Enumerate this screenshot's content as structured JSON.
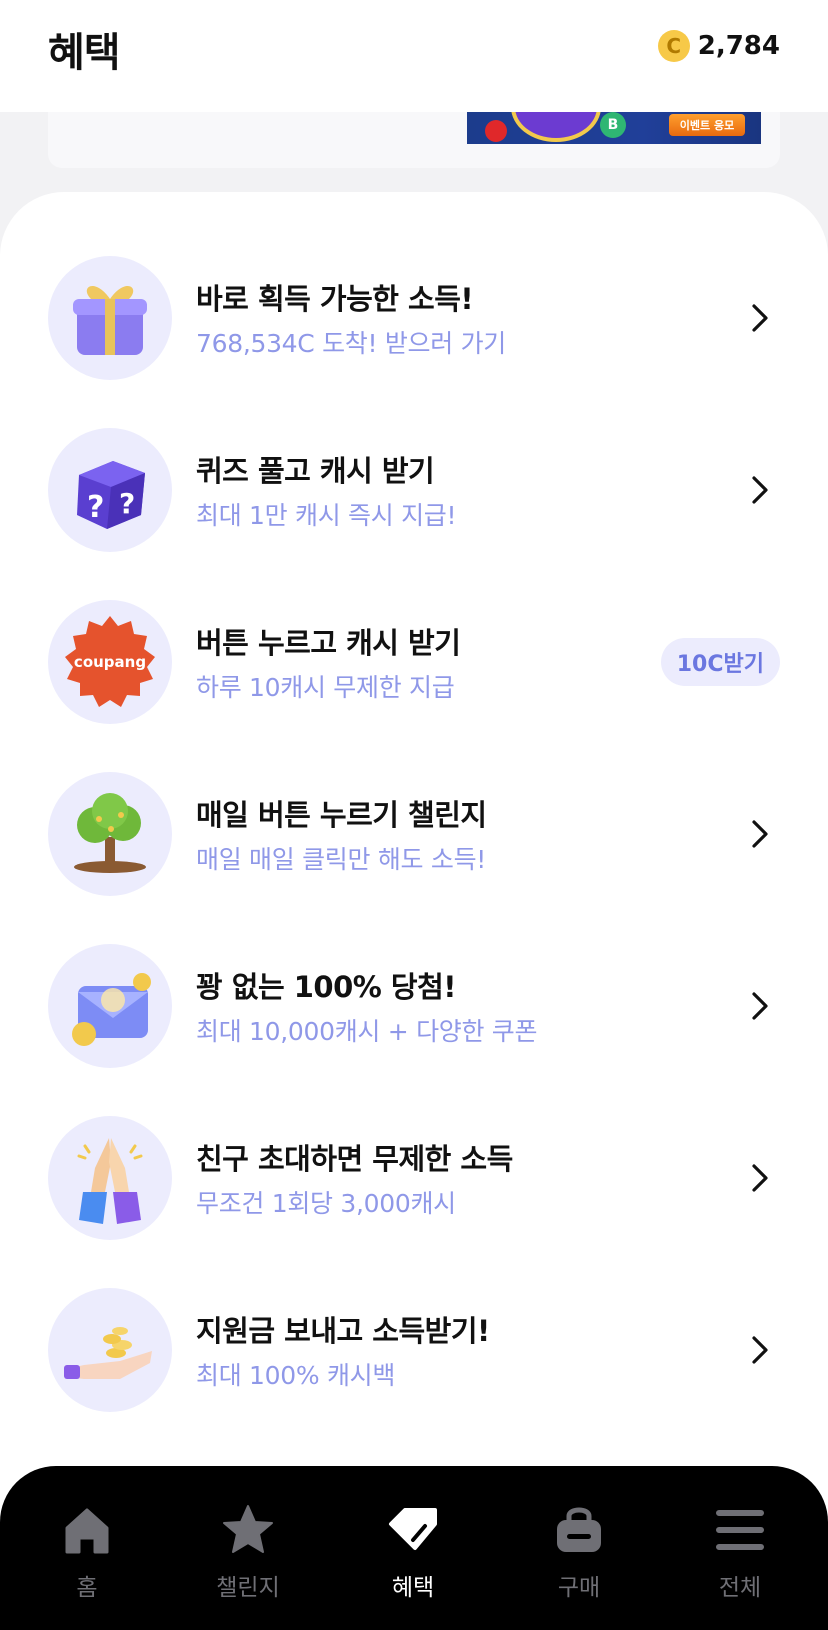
{
  "header": {
    "title": "혜택",
    "coin_symbol": "C",
    "balance": "2,784"
  },
  "banner": {
    "button_label": "이벤트 응모",
    "crypto_symbol": "B"
  },
  "benefits": [
    {
      "icon": "gift-box-icon",
      "title": "바로 획득 가능한 소득!",
      "subtitle": "768,534C 도착! 받으러 가기",
      "action": "chevron"
    },
    {
      "icon": "question-cube-icon",
      "title": "퀴즈 풀고 캐시 받기",
      "subtitle": "최대 1만 캐시 즉시 지급!",
      "action": "chevron"
    },
    {
      "icon": "coupang-logo-icon",
      "icon_text": "coupang",
      "title": "버튼 누르고 캐시 받기",
      "subtitle": "하루 10캐시 무제한 지급",
      "action": "pill",
      "pill_label": "10C받기"
    },
    {
      "icon": "money-tree-icon",
      "title": "매일 버튼 누르기 챌린지",
      "subtitle": "매일 매일 클릭만 해도 소득!",
      "action": "chevron"
    },
    {
      "icon": "envelope-coins-icon",
      "title": "꽝 없는 100% 당첨!",
      "subtitle": "최대 10,000캐시 + 다양한 쿠폰",
      "action": "chevron"
    },
    {
      "icon": "praying-hands-icon",
      "title": "친구 초대하면 무제한 소득",
      "subtitle": "무조건 1회당 3,000캐시",
      "action": "chevron"
    },
    {
      "icon": "hand-coins-icon",
      "title": "지원금 보내고 소득받기!",
      "subtitle": "최대 100% 캐시백",
      "action": "chevron"
    }
  ],
  "nav": {
    "items": [
      {
        "label": "홈",
        "icon": "home-icon",
        "active": false
      },
      {
        "label": "챌린지",
        "icon": "star-icon",
        "active": false
      },
      {
        "label": "혜택",
        "icon": "tag-icon",
        "active": true
      },
      {
        "label": "구매",
        "icon": "shopping-bag-icon",
        "active": false
      },
      {
        "label": "전체",
        "icon": "menu-icon",
        "active": false
      }
    ]
  },
  "colors": {
    "accent_text": "#8f98e8",
    "pill_bg": "#ececfd",
    "pill_text": "#6b77e0",
    "nav_bg": "#000000",
    "nav_inactive": "#6f6f75",
    "coin": "#f7c948"
  }
}
